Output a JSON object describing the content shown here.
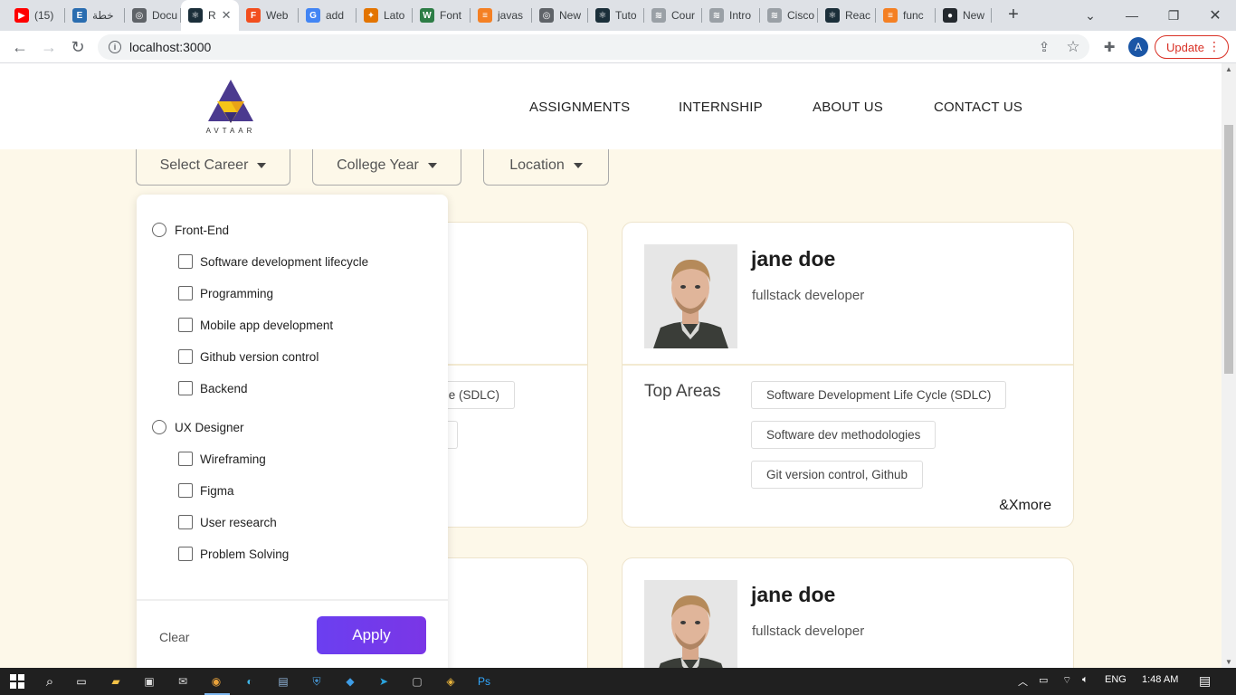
{
  "browser": {
    "tabs": [
      {
        "label": "(15)",
        "icon": "youtube-icon",
        "color": "#ff0000",
        "glyph": "▶"
      },
      {
        "label": "خطة",
        "icon": "e-icon",
        "color": "#2a6db0",
        "glyph": "E"
      },
      {
        "label": "Docu",
        "icon": "globe-icon",
        "color": "#5f6368",
        "glyph": "◎"
      },
      {
        "label": "R",
        "icon": "react-icon",
        "color": "#1b2f3a",
        "glyph": "⚛",
        "active": true
      },
      {
        "label": "Web",
        "icon": "figma-icon",
        "color": "#f24e1e",
        "glyph": "F"
      },
      {
        "label": "add",
        "icon": "google-icon",
        "color": "#4285f4",
        "glyph": "G"
      },
      {
        "label": "Lato",
        "icon": "fonts-icon",
        "color": "#e37400",
        "glyph": "✦"
      },
      {
        "label": "Font",
        "icon": "w-icon",
        "color": "#2d7d46",
        "glyph": "W"
      },
      {
        "label": "javas",
        "icon": "stackoverflow-icon",
        "color": "#f48024",
        "glyph": "≡"
      },
      {
        "label": "New",
        "icon": "chrome-icon",
        "color": "#5f6368",
        "glyph": "◎"
      },
      {
        "label": "Tuto",
        "icon": "react-icon",
        "color": "#1b2f3a",
        "glyph": "⚛"
      },
      {
        "label": "Cour",
        "icon": "cisco-icon",
        "color": "#9aa0a6",
        "glyph": "≋"
      },
      {
        "label": "Intro",
        "icon": "cisco-icon",
        "color": "#9aa0a6",
        "glyph": "≋"
      },
      {
        "label": "Cisco",
        "icon": "cisco-icon",
        "color": "#9aa0a6",
        "glyph": "≋"
      },
      {
        "label": "Reac",
        "icon": "react-icon",
        "color": "#1b2f3a",
        "glyph": "⚛"
      },
      {
        "label": "func",
        "icon": "stackoverflow-icon",
        "color": "#f48024",
        "glyph": "≡"
      },
      {
        "label": "New",
        "icon": "github-icon",
        "color": "#24292e",
        "glyph": "●"
      }
    ],
    "new_tab_glyph": "+",
    "address": "localhost:3000",
    "profile_initial": "A",
    "update_label": "Update"
  },
  "site": {
    "logo_text": "AVTAAR",
    "nav": [
      "ASSIGNMENTS",
      "INTERNSHIP",
      "ABOUT US",
      "CONTACT US"
    ]
  },
  "filters": {
    "career": "Select Career",
    "year": "College Year",
    "location": "Location"
  },
  "dropdown": {
    "groups": [
      {
        "label": "Front-End",
        "options": [
          "Software development lifecycle",
          "Programming",
          "Mobile app development",
          "Github version control",
          "Backend"
        ]
      },
      {
        "label": "UX Designer",
        "options": [
          "Wireframing",
          "Figma",
          "User research",
          "Problem Solving"
        ]
      }
    ],
    "clear_label": "Clear",
    "apply_label": "Apply"
  },
  "cards": [
    {
      "name": "jane doe",
      "role": "fullstack developer",
      "top_areas_label": "Top Areas",
      "chips": [
        "Software Development Life Cycle (SDLC)",
        "Software dev methodologies",
        "Git version control, Github"
      ],
      "more": "&Xmore"
    },
    {
      "name": "jane doe",
      "role": "fullstack developer"
    }
  ],
  "hidden_card_chip_fragment": "cle (SDLC)",
  "taskbar": {
    "language": "ENG",
    "time": "1:48 AM"
  }
}
